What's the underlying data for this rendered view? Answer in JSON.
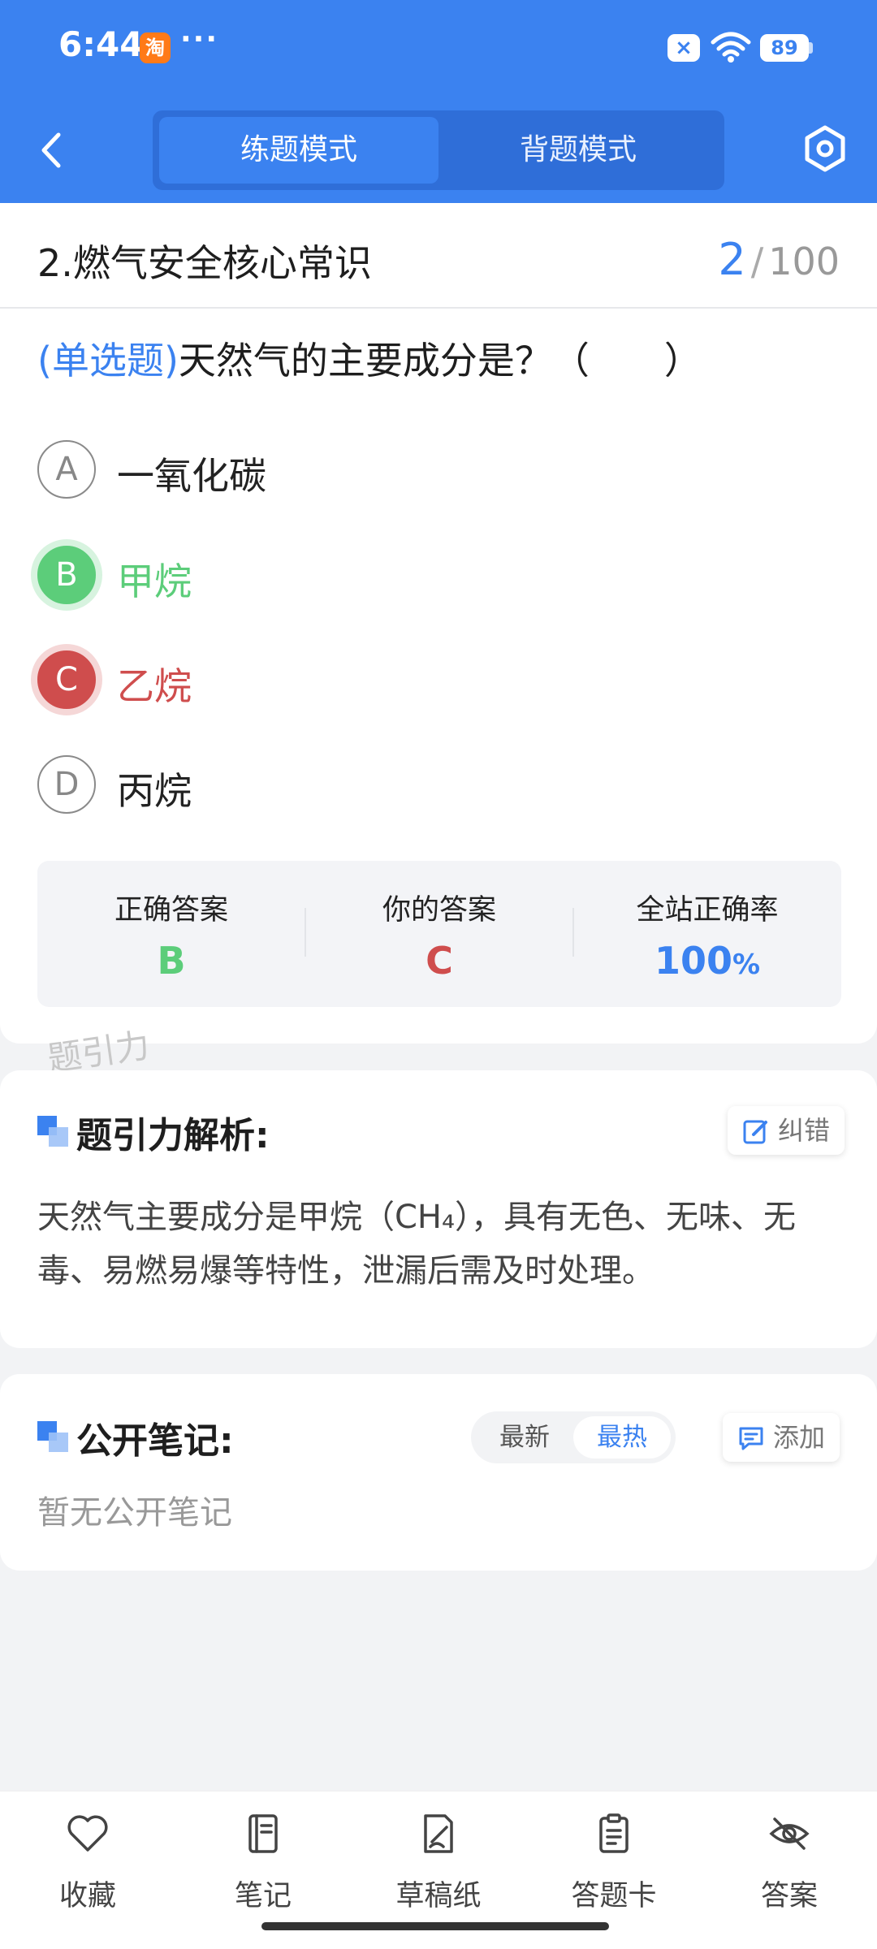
{
  "status_bar": {
    "time": "6:44",
    "app_badge": "淘",
    "more": "···",
    "x_badge": "×",
    "battery": "89"
  },
  "header": {
    "tabs": [
      {
        "label": "练题模式",
        "active": true
      },
      {
        "label": "背题模式",
        "active": false
      }
    ],
    "accent_color": "#3b82f0"
  },
  "question": {
    "section_title": "2.燃气安全核心常识",
    "progress_current": "2",
    "progress_separator": "/",
    "progress_total": "100",
    "type_label": "(单选题)",
    "text": "天然气的主要成分是？（　　）",
    "options": [
      {
        "letter": "A",
        "text": "一氧化碳",
        "state": "normal"
      },
      {
        "letter": "B",
        "text": "甲烷",
        "state": "correct"
      },
      {
        "letter": "C",
        "text": "乙烷",
        "state": "wrong"
      },
      {
        "letter": "D",
        "text": "丙烷",
        "state": "normal"
      }
    ]
  },
  "stats": {
    "correct_label": "正确答案",
    "correct_value": "B",
    "yours_label": "你的答案",
    "yours_value": "C",
    "rate_label": "全站正确率",
    "rate_value": "100",
    "rate_unit": "%",
    "colors": {
      "correct": "#5ccd7a",
      "wrong": "#cf4d4d",
      "rate": "#3b82f0"
    }
  },
  "watermark": "题引力",
  "analysis": {
    "title": "题引力解析:",
    "report_label": "纠错",
    "text": "天然气主要成分是甲烷（CH₄），具有无色、无味、无毒、易燃易爆等特性，泄漏后需及时处理。"
  },
  "notes": {
    "title": "公开笔记:",
    "sort_newest": "最新",
    "sort_hottest": "最热",
    "add_label": "添加",
    "empty_text": "暂无公开笔记"
  },
  "bottom_nav": [
    {
      "label": "收藏",
      "icon": "heart-icon"
    },
    {
      "label": "笔记",
      "icon": "notebook-icon"
    },
    {
      "label": "草稿纸",
      "icon": "draft-paper-icon"
    },
    {
      "label": "答题卡",
      "icon": "answer-sheet-icon"
    },
    {
      "label": "答案",
      "icon": "eye-off-icon"
    }
  ]
}
